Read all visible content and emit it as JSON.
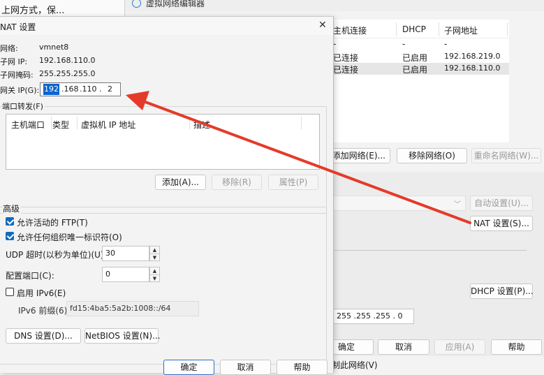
{
  "bg_left_text": "上网方式，保...",
  "editor": {
    "title": "虚拟网络编辑器",
    "table_headers": [
      "主机连接",
      "DHCP",
      "子网地址"
    ],
    "rows": [
      [
        "-",
        "-",
        "-"
      ],
      [
        "已连接",
        "已启用",
        "192.168.219.0"
      ],
      [
        "已连接",
        "已启用",
        "192.168.110.0"
      ]
    ],
    "add_network": "添加网络(E)...",
    "remove_network": "移除网络(O)",
    "rename_network": "重命名网络(W)...",
    "auto_settings": "自动设置(U)...",
    "nat_settings": "NAT 设置(S)...",
    "dhcp_settings": "DHCP 设置(P)...",
    "subnet_mask_value": "255 .255 .255 . 0",
    "ok": "确定",
    "cancel": "取消",
    "apply": "应用(A)",
    "help": "帮助",
    "bottom_partial": "制此网络(V)"
  },
  "nat": {
    "title": "NAT 设置",
    "network_label": "网络:",
    "network_value": "vmnet8",
    "subnet_ip_label": "子网 IP:",
    "subnet_ip_value": "192.168.110.0",
    "subnet_mask_label": "子网掩码:",
    "subnet_mask_value": "255.255.255.0",
    "gateway_label": "网关 IP(G):",
    "gateway_octets": [
      "192",
      ".168",
      ".110",
      ".",
      "2"
    ],
    "port_forwarding_label": "端口转发(F)",
    "pf_headers": [
      "主机端口",
      "类型",
      "虚拟机 IP 地址",
      "描述"
    ],
    "add_btn": "添加(A)...",
    "remove_btn": "移除(R)",
    "props_btn": "属性(P)",
    "advanced_label": "高级",
    "allow_ftp": "允许活动的 FTP(T)",
    "allow_ftp_checked": true,
    "allow_org": "允许任何组织唯一标识符(O)",
    "allow_org_checked": true,
    "udp_timeout_label": "UDP 超时(以秒为单位)(U):",
    "udp_timeout_value": "30",
    "config_port_label": "配置端口(C):",
    "config_port_value": "0",
    "enable_ipv6": "启用 IPv6(E)",
    "enable_ipv6_checked": false,
    "ipv6_prefix_label": "IPv6 前缀(6):",
    "ipv6_prefix_value": "fd15:4ba5:5a2b:1008::/64",
    "dns_btn": "DNS 设置(D)...",
    "netbios_btn": "NetBIOS 设置(N)...",
    "ok": "确定",
    "cancel": "取消",
    "help": "帮助",
    "close_glyph": "✕"
  },
  "colors": {
    "arrow": "#e53a2a",
    "selection": "#0a64d0",
    "accent": "#0f6cbd"
  }
}
